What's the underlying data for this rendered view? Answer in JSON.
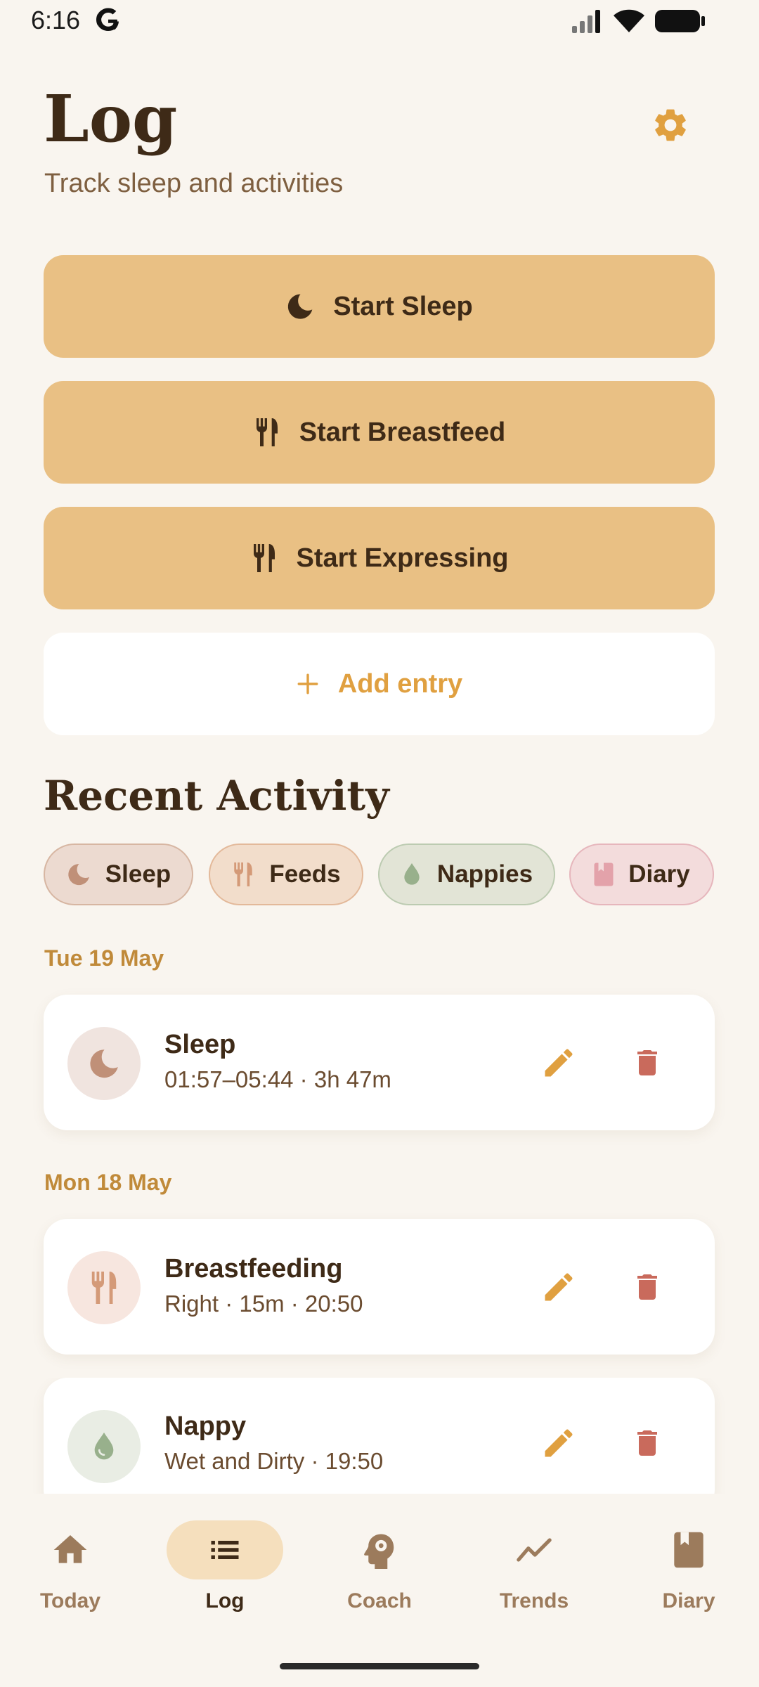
{
  "status_bar": {
    "time": "6:16"
  },
  "header": {
    "title": "Log",
    "subtitle": "Track sleep and activities"
  },
  "actions": {
    "start_sleep": "Start Sleep",
    "start_breastfeed": "Start Breastfeed",
    "start_expressing": "Start Expressing",
    "add_entry": "Add entry"
  },
  "recent": {
    "title": "Recent Activity",
    "filters": [
      "Sleep",
      "Feeds",
      "Nappies",
      "Diary"
    ],
    "groups": [
      {
        "date": "Tue 19 May",
        "entries": [
          {
            "title": "Sleep",
            "detail": "01:57–05:44 · 3h 47m",
            "icon": "moon-icon"
          }
        ]
      },
      {
        "date": "Mon 18 May",
        "entries": [
          {
            "title": "Breastfeeding",
            "detail": "Right · 15m · 20:50",
            "icon": "utensils-icon"
          },
          {
            "title": "Nappy",
            "detail": "Wet and Dirty · 19:50",
            "icon": "droplet-icon"
          }
        ]
      }
    ]
  },
  "nav": {
    "items": [
      "Today",
      "Log",
      "Coach",
      "Trends",
      "Diary"
    ],
    "active": "Log"
  },
  "colors": {
    "background": "#f9f5ef",
    "action_button": "#e9c084",
    "accent": "#e0a040",
    "delete": "#c96a5c",
    "text_dark": "#3e2a17"
  }
}
